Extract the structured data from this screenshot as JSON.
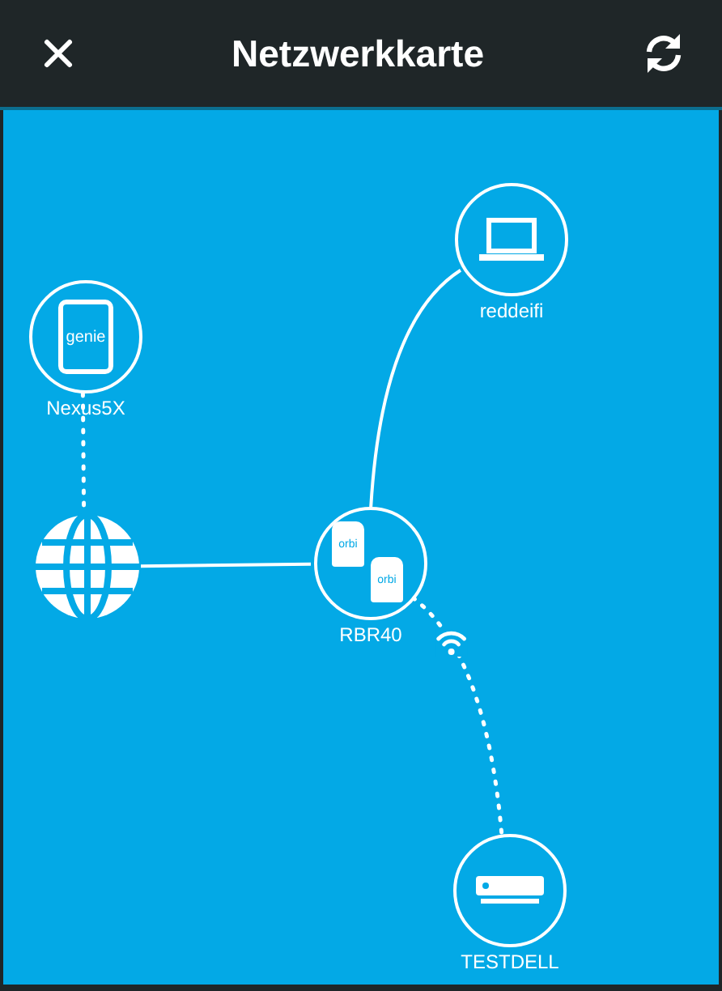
{
  "header": {
    "title": "Netzwerkkarte"
  },
  "nodes": [
    {
      "kind": "phone",
      "label": "Nexus5X",
      "icon_text": "genie"
    },
    {
      "kind": "internet"
    },
    {
      "kind": "router",
      "label": "RBR40",
      "icon_text": [
        "orbi",
        "orbi"
      ]
    },
    {
      "kind": "laptop",
      "label": "reddeifi"
    },
    {
      "kind": "desktop",
      "label": "TESTDELL"
    }
  ],
  "links": [
    {
      "kind": "wireless"
    },
    {
      "kind": "wired"
    },
    {
      "kind": "wired"
    },
    {
      "kind": "wireless"
    }
  ]
}
